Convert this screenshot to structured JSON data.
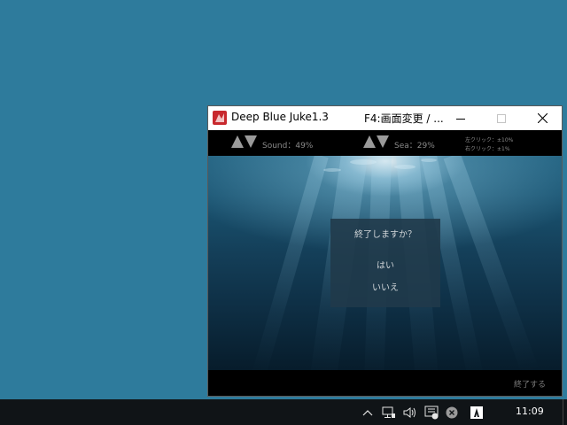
{
  "window": {
    "title": "Deep Blue Juke1.3",
    "hint": "F4:画面変更 / ...",
    "controls": {
      "sound_label": "Sound：49%",
      "sea_label": "Sea：29%",
      "help_line1": "左クリック：±10%",
      "help_line2": "右クリック：±1%"
    },
    "dialog": {
      "title": "終了しますか？",
      "yes": "はい",
      "no": "いいえ"
    },
    "footer": {
      "quit": "終了する"
    }
  },
  "taskbar": {
    "clock": "11:09",
    "tray_icons": [
      "chevron-up-icon",
      "network-icon",
      "volume-icon",
      "action-center-icon",
      "close-circle-icon",
      "adobe-icon"
    ]
  },
  "colors": {
    "desktop": "#2e7b9c",
    "taskbar": "#101417",
    "app_icon": "#c8282d"
  }
}
